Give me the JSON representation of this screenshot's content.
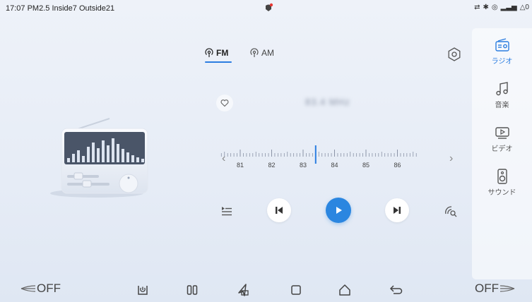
{
  "status": {
    "time": "17:07",
    "pm25": "PM2.5 Inside7 Outside21",
    "right_text": "△0"
  },
  "bands": [
    {
      "label": "FM",
      "active": true
    },
    {
      "label": "AM",
      "active": false
    }
  ],
  "station": {
    "name": "83.4 MHz"
  },
  "dial": {
    "ticks": [
      "81",
      "82",
      "83",
      "84",
      "85",
      "86"
    ],
    "current_frequency": 83.4
  },
  "sidebar": {
    "items": [
      {
        "label": "ラジオ",
        "icon": "radio-icon",
        "active": true
      },
      {
        "label": "音楽",
        "icon": "music-note-icon",
        "active": false
      },
      {
        "label": "ビデオ",
        "icon": "video-icon",
        "active": false
      },
      {
        "label": "サウンド",
        "icon": "speaker-icon",
        "active": false
      }
    ]
  },
  "bottom": {
    "left_fan": "OFF",
    "right_fan": "OFF"
  },
  "colors": {
    "accent": "#2b7de0",
    "play": "#2b86e0"
  }
}
